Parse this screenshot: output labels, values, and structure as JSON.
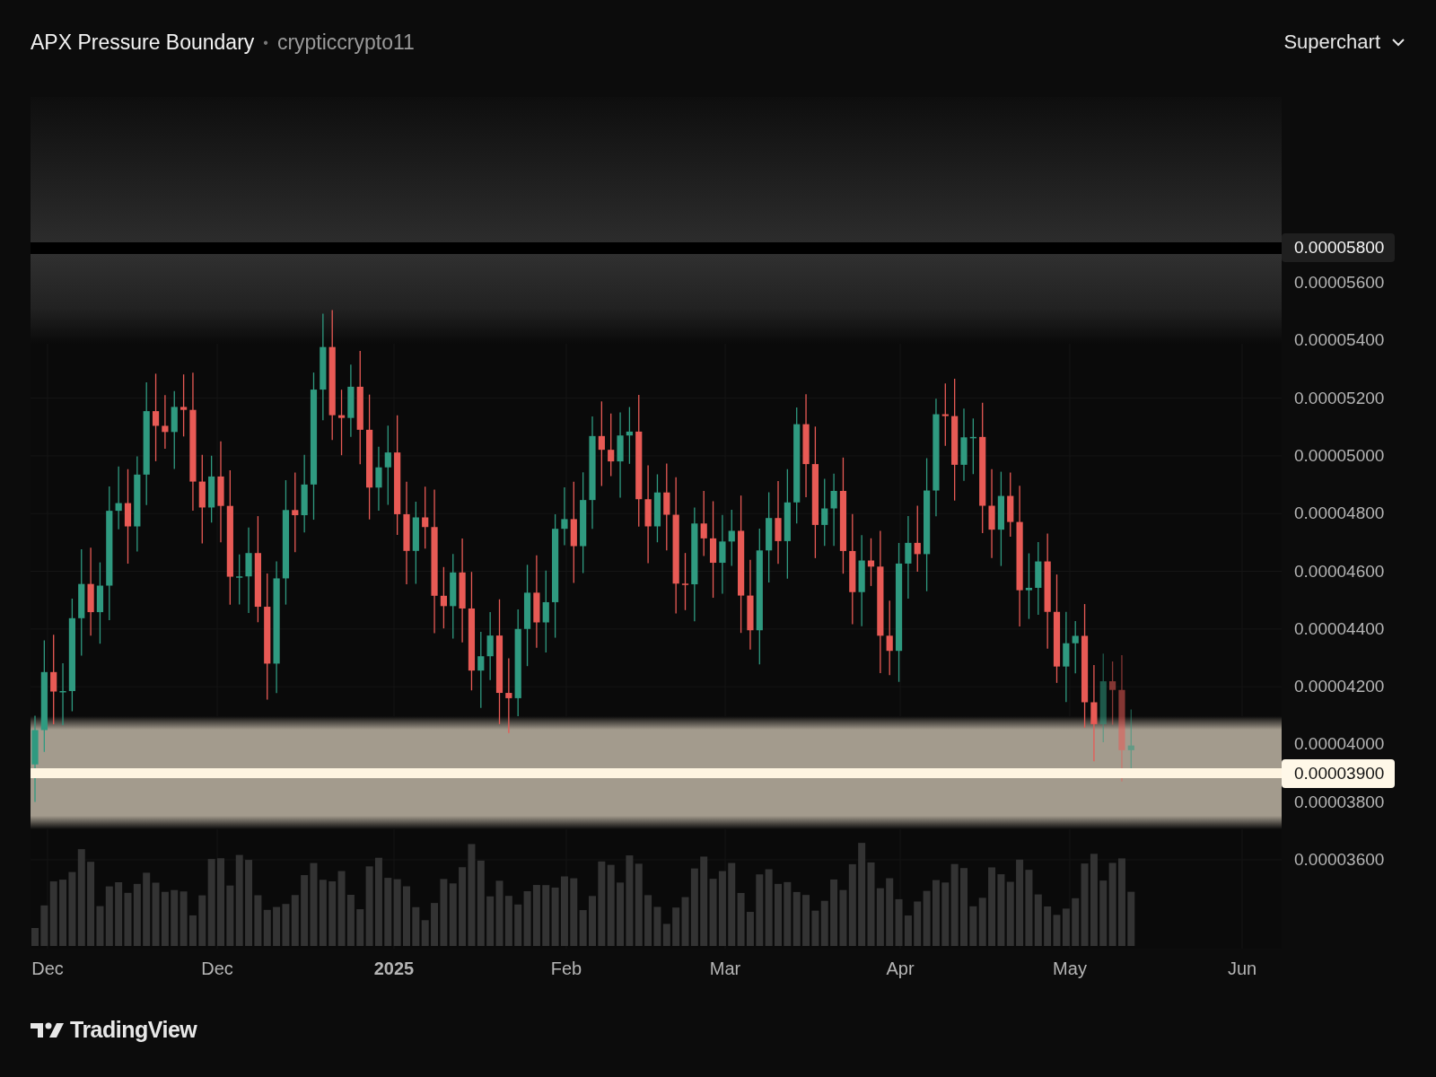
{
  "header": {
    "title": "APX Pressure Boundary",
    "separator": "•",
    "author": "crypticcrypto11",
    "layout_menu": "Superchart"
  },
  "chart": {
    "price_tags": [
      {
        "label": "0.00005800",
        "kind": "dark"
      },
      {
        "label": "0.00003900",
        "kind": "light"
      }
    ],
    "price_ticks": [
      "0.00005600",
      "0.00005400",
      "0.00005200",
      "0.00005000",
      "0.00004800",
      "0.00004600",
      "0.00004400",
      "0.00004200",
      "0.00004000",
      "0.00003800",
      "0.00003600"
    ],
    "time_axis": [
      {
        "label": "Dec",
        "bold": false
      },
      {
        "label": "Dec",
        "bold": false
      },
      {
        "label": "2025",
        "bold": true
      },
      {
        "label": "Feb",
        "bold": false
      },
      {
        "label": "Mar",
        "bold": false
      },
      {
        "label": "Apr",
        "bold": false
      },
      {
        "label": "May",
        "bold": false
      },
      {
        "label": "Jun",
        "bold": false
      }
    ]
  },
  "footer": {
    "logo": "TradingView"
  }
}
